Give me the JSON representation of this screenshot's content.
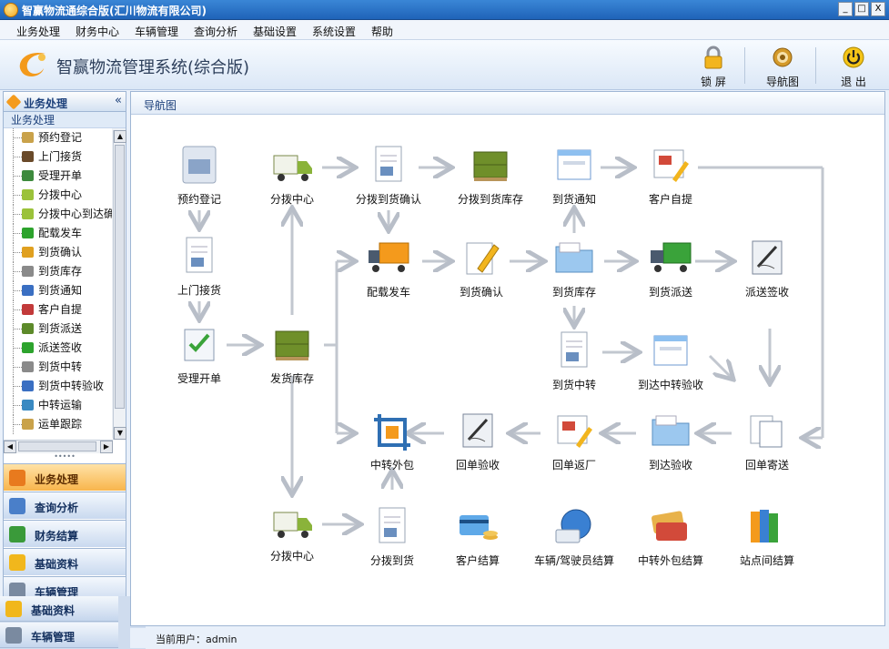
{
  "window": {
    "title": "智赢物流通综合版(汇川物流有限公司)",
    "min": "_",
    "max": "□",
    "close": "X"
  },
  "menu": [
    "业务处理",
    "财务中心",
    "车辆管理",
    "查询分析",
    "基础设置",
    "系统设置",
    "帮助"
  ],
  "header": {
    "app_title": "智赢物流管理系统(综合版)",
    "tools": [
      {
        "label": "锁 屏",
        "icon": "lock-icon"
      },
      {
        "label": "导航图",
        "icon": "gear-icon"
      },
      {
        "label": "退 出",
        "icon": "power-icon"
      }
    ]
  },
  "sidebar": {
    "heading": "业务处理",
    "collapse": "«",
    "sub_heading": "业务处理",
    "tree": [
      {
        "label": "预约登记",
        "color": "#c9a24a"
      },
      {
        "label": "上门接货",
        "color": "#6a4a2a"
      },
      {
        "label": "受理开单",
        "color": "#3d8a3d"
      },
      {
        "label": "分拨中心",
        "color": "#9bc23a"
      },
      {
        "label": "分拨中心到达确",
        "color": "#9bc23a"
      },
      {
        "label": "配载发车",
        "color": "#2da32d"
      },
      {
        "label": "到货确认",
        "color": "#e0a020"
      },
      {
        "label": "到货库存",
        "color": "#8a8a8a"
      },
      {
        "label": "到货通知",
        "color": "#3a6fc2"
      },
      {
        "label": "客户自提",
        "color": "#c23a3a"
      },
      {
        "label": "到货派送",
        "color": "#5d8a2a"
      },
      {
        "label": "派送签收",
        "color": "#2da32d"
      },
      {
        "label": "到货中转",
        "color": "#8a8a8a"
      },
      {
        "label": "到货中转验收",
        "color": "#3a6fc2"
      },
      {
        "label": "中转运输",
        "color": "#3a8ac2"
      },
      {
        "label": "运单跟踪",
        "color": "#c9a24a"
      }
    ],
    "splitter": "•••••",
    "nav": [
      {
        "label": "业务处理",
        "icon": "cart-icon",
        "color": "#e87a1e",
        "active": true
      },
      {
        "label": "查询分析",
        "icon": "magnifier-icon",
        "color": "#4a7fc9"
      },
      {
        "label": "财务结算",
        "icon": "chart-icon",
        "color": "#3a9a3a"
      },
      {
        "label": "基础资料",
        "icon": "bulb-icon",
        "color": "#f1b71c"
      },
      {
        "label": "车辆管理",
        "icon": "truck-icon",
        "color": "#7a8aa0"
      }
    ],
    "floating": [
      {
        "label": "基础资料",
        "icon": "bulb-icon",
        "color": "#f1b71c"
      },
      {
        "label": "车辆管理",
        "icon": "truck-icon",
        "color": "#7a8aa0"
      }
    ]
  },
  "content": {
    "tab": "导航图",
    "nodes": [
      {
        "id": "n1",
        "label": "预约登记",
        "icon": "form-icon"
      },
      {
        "id": "n2",
        "label": "上门接货",
        "icon": "document-icon"
      },
      {
        "id": "n3",
        "label": "受理开单",
        "icon": "checklist-icon"
      },
      {
        "id": "n4",
        "label": "分拨中心",
        "icon": "truck-icon"
      },
      {
        "id": "n5",
        "label": "发货库存",
        "icon": "pallet-icon"
      },
      {
        "id": "n6",
        "label": "分拨到货确认",
        "icon": "document-icon"
      },
      {
        "id": "n7",
        "label": "分拨到货库存",
        "icon": "pallet-icon"
      },
      {
        "id": "n8",
        "label": "到货通知",
        "icon": "window-icon"
      },
      {
        "id": "n9",
        "label": "客户自提",
        "icon": "picture-pen-icon"
      },
      {
        "id": "n10",
        "label": "配载发车",
        "icon": "lorry-icon"
      },
      {
        "id": "n11",
        "label": "到货确认",
        "icon": "pen-icon"
      },
      {
        "id": "n12",
        "label": "到货库存",
        "icon": "folder-icon"
      },
      {
        "id": "n13",
        "label": "到货派送",
        "icon": "green-truck-icon"
      },
      {
        "id": "n14",
        "label": "派送签收",
        "icon": "sign-icon"
      },
      {
        "id": "n15",
        "label": "到货中转",
        "icon": "document-icon"
      },
      {
        "id": "n16",
        "label": "到达中转验收",
        "icon": "window-icon"
      },
      {
        "id": "n17",
        "label": "中转外包",
        "icon": "crop-icon"
      },
      {
        "id": "n18",
        "label": "回单验收",
        "icon": "sign-icon"
      },
      {
        "id": "n19",
        "label": "回单返厂",
        "icon": "picture-pen-icon"
      },
      {
        "id": "n20",
        "label": "到达验收",
        "icon": "folder-icon"
      },
      {
        "id": "n21",
        "label": "回单寄送",
        "icon": "files-icon"
      },
      {
        "id": "n22",
        "label": "分拨中心",
        "icon": "truck-icon"
      },
      {
        "id": "n23",
        "label": "分拨到货",
        "icon": "document-icon"
      },
      {
        "id": "n24",
        "label": "客户结算",
        "icon": "card-coins-icon"
      },
      {
        "id": "n25",
        "label": "车辆/驾驶员结算",
        "icon": "globe-card-icon"
      },
      {
        "id": "n26",
        "label": "中转外包结算",
        "icon": "cards-icon"
      },
      {
        "id": "n27",
        "label": "站点间结算",
        "icon": "books-icon"
      }
    ]
  },
  "status": {
    "current_user": "当前用户：admin"
  }
}
